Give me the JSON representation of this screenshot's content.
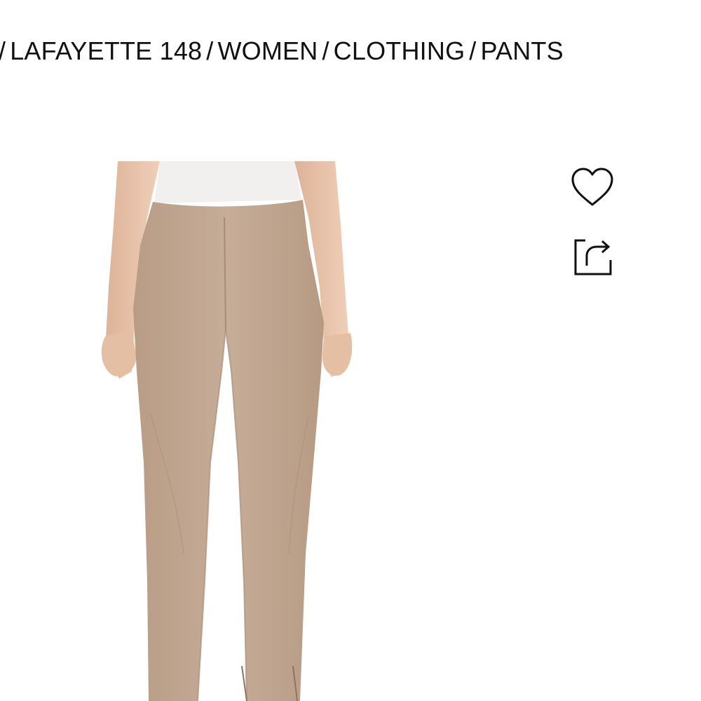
{
  "breadcrumb": {
    "items": [
      "/",
      "LAFAYETTE 148",
      "/",
      "WOMEN",
      "/",
      "CLOTHING",
      "/",
      "PANTS"
    ]
  },
  "product": {
    "image_icon": "product-photo",
    "colors": {
      "pants": "#c2a892",
      "skin": "#e9c6ad",
      "top": "#f2f0ef"
    }
  },
  "actions": {
    "wishlist_icon": "heart-icon",
    "share_icon": "share-icon"
  }
}
